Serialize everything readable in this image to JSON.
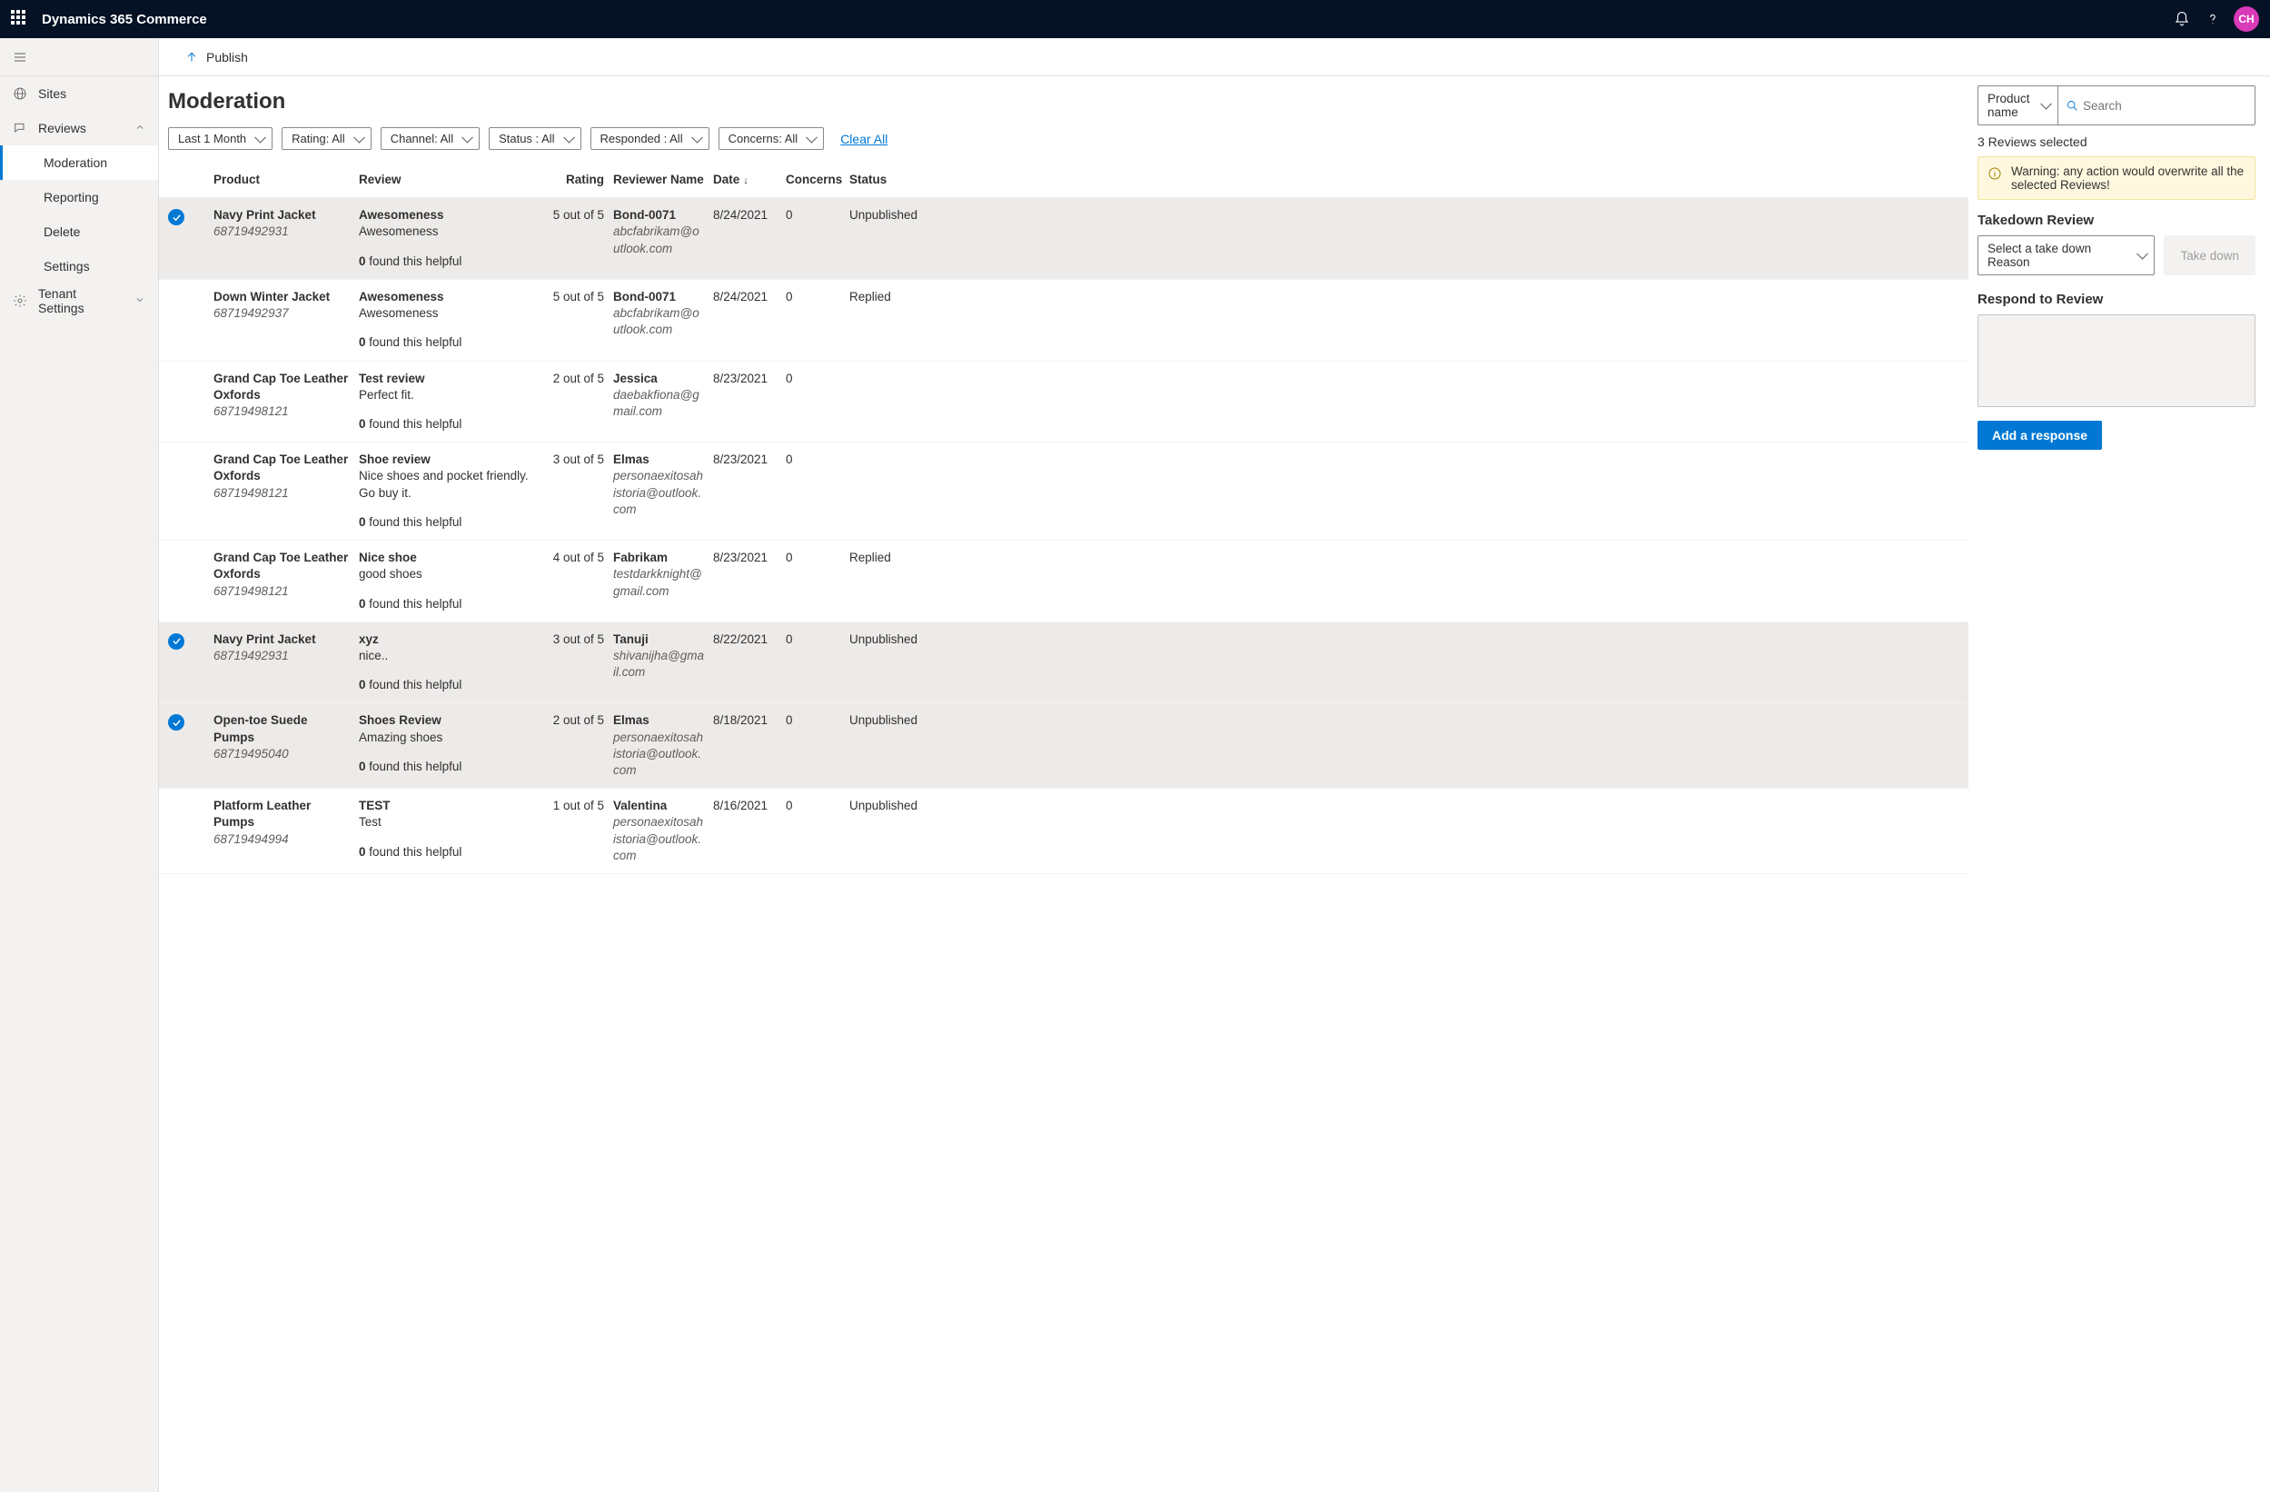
{
  "brand": "Dynamics 365 Commerce",
  "avatar_initials": "CH",
  "sidebar": {
    "sites": "Sites",
    "reviews": "Reviews",
    "moderation": "Moderation",
    "reporting": "Reporting",
    "delete": "Delete",
    "settings": "Settings",
    "tenant_settings": "Tenant Settings"
  },
  "cmd": {
    "publish": "Publish"
  },
  "page_title": "Moderation",
  "filters": {
    "time": "Last 1 Month",
    "rating": "Rating: All",
    "channel": "Channel: All",
    "status": "Status : All",
    "responded": "Responded : All",
    "concerns": "Concerns: All",
    "clear": "Clear All"
  },
  "headers": {
    "product": "Product",
    "review": "Review",
    "rating": "Rating",
    "reviewer": "Reviewer Name",
    "date": "Date",
    "concerns": "Concerns",
    "status": "Status"
  },
  "rows": [
    {
      "selected": true,
      "product": "Navy Print Jacket",
      "sku": "68719492931",
      "title": "Awesomeness",
      "body": "Awesomeness",
      "helpful": "0",
      "rating": "5 out of 5",
      "reviewer": "Bond-0071",
      "email": "abcfabrikam@outlook.com",
      "date": "8/24/2021",
      "concerns": "0",
      "status": "Unpublished"
    },
    {
      "selected": false,
      "product": "Down Winter Jacket",
      "sku": "68719492937",
      "title": "Awesomeness",
      "body": "Awesomeness",
      "helpful": "0",
      "rating": "5 out of 5",
      "reviewer": "Bond-0071",
      "email": "abcfabrikam@outlook.com",
      "date": "8/24/2021",
      "concerns": "0",
      "status": "Replied"
    },
    {
      "selected": false,
      "product": "Grand Cap Toe Leather Oxfords",
      "sku": "68719498121",
      "title": "Test review",
      "body": "Perfect fit.",
      "helpful": "0",
      "rating": "2 out of 5",
      "reviewer": "Jessica",
      "email": "daebakfiona@gmail.com",
      "date": "8/23/2021",
      "concerns": "0",
      "status": ""
    },
    {
      "selected": false,
      "product": "Grand Cap Toe Leather Oxfords",
      "sku": "68719498121",
      "title": "Shoe review",
      "body": "Nice shoes and pocket friendly. Go buy it.",
      "helpful": "0",
      "rating": "3 out of 5",
      "reviewer": "Elmas",
      "email": "personaexitosahistoria@outlook.com",
      "date": "8/23/2021",
      "concerns": "0",
      "status": ""
    },
    {
      "selected": false,
      "product": "Grand Cap Toe Leather Oxfords",
      "sku": "68719498121",
      "title": "Nice shoe",
      "body": "good shoes",
      "helpful": "0",
      "rating": "4 out of 5",
      "reviewer": "Fabrikam",
      "email": "testdarkknight@gmail.com",
      "date": "8/23/2021",
      "concerns": "0",
      "status": "Replied"
    },
    {
      "selected": true,
      "product": "Navy Print Jacket",
      "sku": "68719492931",
      "title": "xyz",
      "body": "nice..",
      "helpful": "0",
      "rating": "3 out of 5",
      "reviewer": "Tanuji",
      "email": "shivanijha@gmail.com",
      "date": "8/22/2021",
      "concerns": "0",
      "status": "Unpublished"
    },
    {
      "selected": true,
      "product": "Open-toe Suede Pumps",
      "sku": "68719495040",
      "title": "Shoes Review",
      "body": "Amazing shoes",
      "helpful": "0",
      "rating": "2 out of 5",
      "reviewer": "Elmas",
      "email": "personaexitosahistoria@outlook.com",
      "date": "8/18/2021",
      "concerns": "0",
      "status": "Unpublished"
    },
    {
      "selected": false,
      "product": "Platform Leather Pumps",
      "sku": "68719494994",
      "title": "TEST",
      "body": "Test",
      "helpful": "0",
      "rating": "1 out of 5",
      "reviewer": "Valentina",
      "email": "personaexitosahistoria@outlook.com",
      "date": "8/16/2021",
      "concerns": "0",
      "status": "Unpublished"
    }
  ],
  "helpful_suffix": " found this helpful",
  "rpanel": {
    "search_mode": "Product name",
    "search_placeholder": "Search",
    "selected_info": "3 Reviews selected",
    "warning": "Warning: any action would overwrite all the selected Reviews!",
    "takedown_title": "Takedown Review",
    "takedown_placeholder": "Select a take down Reason",
    "takedown_btn": "Take down",
    "respond_title": "Respond to Review",
    "add_response": "Add a response"
  }
}
